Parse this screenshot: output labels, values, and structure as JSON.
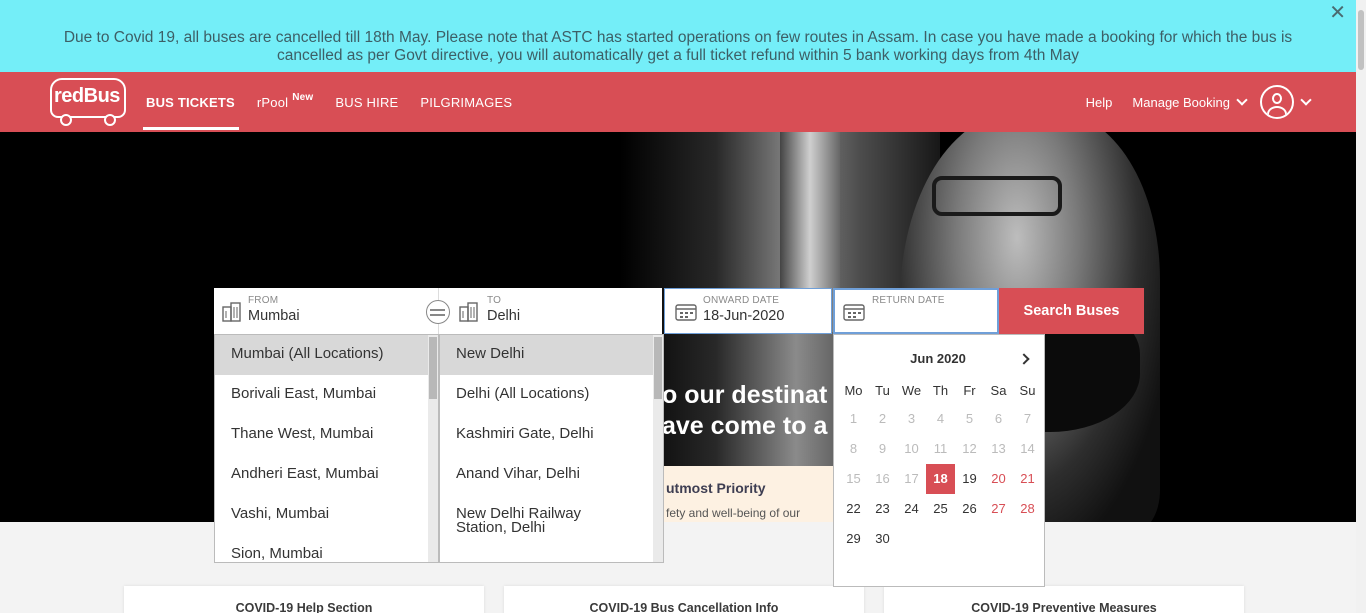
{
  "banner": {
    "text": "Due to Covid 19, all buses are cancelled till 18th May. Please note that ASTC has started operations on few routes in Assam. In case you have made a booking for which the bus is cancelled as per Govt directive, you will automatically get a full ticket refund within 5 bank working days from 4th May",
    "close": "✕"
  },
  "header": {
    "logo_text": "redBus",
    "nav": [
      {
        "label": "BUS TICKETS",
        "badge": ""
      },
      {
        "label": "rPool",
        "badge": "New"
      },
      {
        "label": "BUS HIRE",
        "badge": ""
      },
      {
        "label": "PILGRIMAGES",
        "badge": ""
      }
    ],
    "help": "Help",
    "manage_booking": "Manage Booking"
  },
  "hero": {
    "title_line1": "o our destinat",
    "title_line2": "ave come to a",
    "promo_title": "utmost Priority",
    "promo_text": "fety and well-being of our"
  },
  "search": {
    "from_label": "FROM",
    "from_value": "Mumbai",
    "to_label": "TO",
    "to_value": "Delhi",
    "onward_label": "ONWARD DATE",
    "onward_value": "18-Jun-2020",
    "return_label": "RETURN DATE",
    "return_value": "",
    "button": "Search Buses"
  },
  "from_suggestions": [
    "Mumbai (All Locations)",
    "Borivali East, Mumbai",
    "Thane West, Mumbai",
    "Andheri East, Mumbai",
    "Vashi, Mumbai",
    "Sion, Mumbai"
  ],
  "to_suggestions": [
    "New Delhi",
    "Delhi (All Locations)",
    "Kashmiri Gate, Delhi",
    "Anand Vihar, Delhi",
    "New Delhi Railway Station, Delhi"
  ],
  "calendar": {
    "month": "Jun 2020",
    "weekdays": [
      "Mo",
      "Tu",
      "We",
      "Th",
      "Fr",
      "Sa",
      "Su"
    ],
    "days": [
      1,
      2,
      3,
      4,
      5,
      6,
      7,
      8,
      9,
      10,
      11,
      12,
      13,
      14,
      15,
      16,
      17,
      18,
      19,
      20,
      21,
      22,
      23,
      24,
      25,
      26,
      27,
      28,
      29,
      30
    ],
    "selected_day": 18,
    "past_through": 17,
    "weekend_future": [
      20,
      21,
      27,
      28
    ]
  },
  "cards": [
    "COVID-19 Help Section",
    "COVID-19 Bus Cancellation Info",
    "COVID-19 Preventive Measures"
  ]
}
